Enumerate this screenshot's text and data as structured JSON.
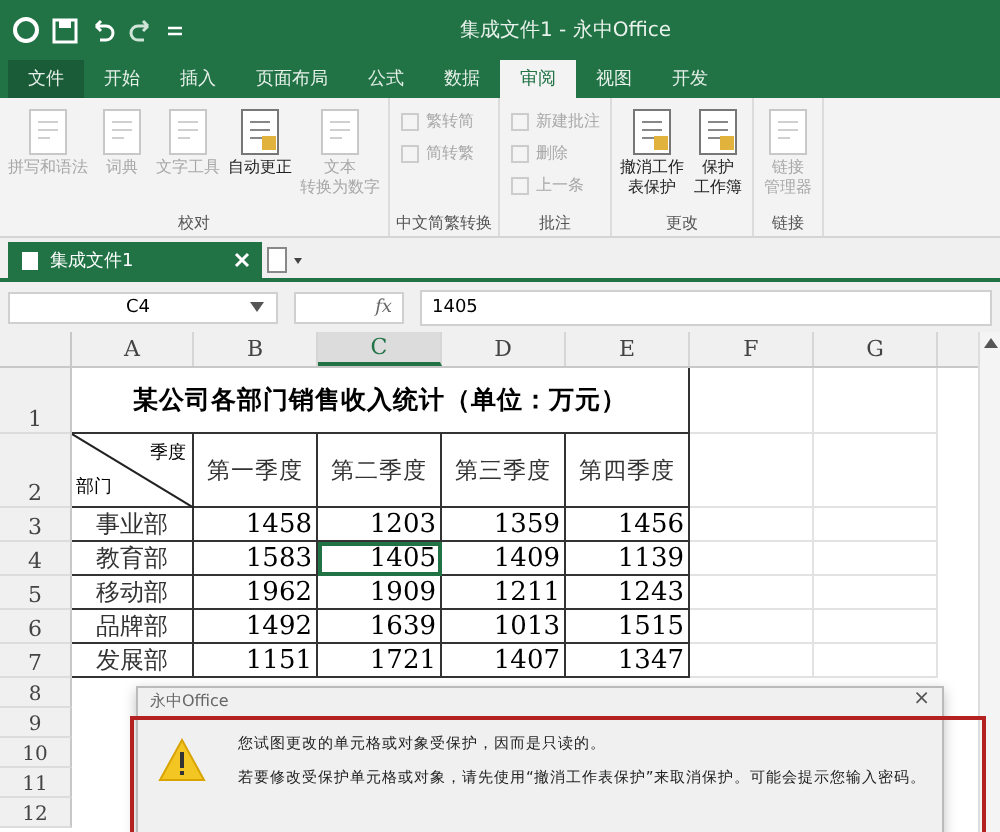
{
  "window": {
    "title": "集成文件1 - 永中Office"
  },
  "menu_tabs": [
    {
      "label": "文件",
      "selected": false,
      "kind": "file"
    },
    {
      "label": "开始",
      "selected": false,
      "kind": "tab"
    },
    {
      "label": "插入",
      "selected": false,
      "kind": "tab"
    },
    {
      "label": "页面布局",
      "selected": false,
      "kind": "tab"
    },
    {
      "label": "公式",
      "selected": false,
      "kind": "tab"
    },
    {
      "label": "数据",
      "selected": false,
      "kind": "tab"
    },
    {
      "label": "审阅",
      "selected": true,
      "kind": "tab"
    },
    {
      "label": "视图",
      "selected": false,
      "kind": "tab"
    },
    {
      "label": "开发",
      "selected": false,
      "kind": "tab"
    }
  ],
  "ribbon": {
    "groups": [
      {
        "label": "校对",
        "items": [
          {
            "lines": [
              "拼写和语法"
            ],
            "kind": "large",
            "disabled": true
          },
          {
            "lines": [
              "词典"
            ],
            "kind": "large",
            "disabled": true
          },
          {
            "lines": [
              "文字工具"
            ],
            "kind": "large",
            "disabled": true
          },
          {
            "lines": [
              "自动更正"
            ],
            "kind": "large",
            "disabled": false
          },
          {
            "lines": [
              "文本",
              "转换为数字"
            ],
            "kind": "large",
            "disabled": true
          }
        ]
      },
      {
        "label": "中文简繁转换",
        "items": [
          {
            "label": "繁转简",
            "kind": "small",
            "disabled": true
          },
          {
            "label": "简转繁",
            "kind": "small",
            "disabled": true
          }
        ]
      },
      {
        "label": "批注",
        "items": [
          {
            "label": "新建批注",
            "kind": "small",
            "disabled": true
          },
          {
            "label": "删除",
            "kind": "small",
            "disabled": true
          },
          {
            "label": "上一条",
            "kind": "small",
            "disabled": true
          }
        ]
      },
      {
        "label": "更改",
        "items": [
          {
            "lines": [
              "撤消工作",
              "表保护"
            ],
            "kind": "large",
            "disabled": false
          },
          {
            "lines": [
              "保护",
              "工作簿"
            ],
            "kind": "large",
            "disabled": false
          }
        ]
      },
      {
        "label": "链接",
        "items": [
          {
            "lines": [
              "链接",
              "管理器"
            ],
            "kind": "large",
            "disabled": true
          }
        ]
      }
    ]
  },
  "doc_tabs": [
    {
      "label": "集成文件1",
      "selected": true
    }
  ],
  "formula_bar": {
    "cell": "C4",
    "fx": "fx",
    "value": "1405"
  },
  "sheet": {
    "columns": [
      {
        "label": "A",
        "selected": false
      },
      {
        "label": "B",
        "selected": false
      },
      {
        "label": "C",
        "selected": true
      },
      {
        "label": "D",
        "selected": false
      },
      {
        "label": "E",
        "selected": false
      },
      {
        "label": "F",
        "selected": false
      },
      {
        "label": "G",
        "selected": false
      }
    ],
    "title_row": {
      "number": "1",
      "text": "某公司各部门销售收入统计（单位：万元）"
    },
    "header_row": {
      "number": "2",
      "corner_top": "季度",
      "corner_bottom": "部门",
      "quarters": [
        "第一季度",
        "第二季度",
        "第三季度",
        "第四季度"
      ]
    },
    "rows": [
      {
        "number": "3",
        "dept": "事业部",
        "values": [
          {
            "text": "1458",
            "selected": false
          },
          {
            "text": "1203",
            "selected": false
          },
          {
            "text": "1359",
            "selected": false
          },
          {
            "text": "1456",
            "selected": false
          }
        ]
      },
      {
        "number": "4",
        "dept": "教育部",
        "values": [
          {
            "text": "1583",
            "selected": false
          },
          {
            "text": "1405",
            "selected": true
          },
          {
            "text": "1409",
            "selected": false
          },
          {
            "text": "1139",
            "selected": false
          }
        ]
      },
      {
        "number": "5",
        "dept": "移动部",
        "values": [
          {
            "text": "1962",
            "selected": false
          },
          {
            "text": "1909",
            "selected": false
          },
          {
            "text": "1211",
            "selected": false
          },
          {
            "text": "1243",
            "selected": false
          }
        ]
      },
      {
        "number": "6",
        "dept": "品牌部",
        "values": [
          {
            "text": "1492",
            "selected": false
          },
          {
            "text": "1639",
            "selected": false
          },
          {
            "text": "1013",
            "selected": false
          },
          {
            "text": "1515",
            "selected": false
          }
        ]
      },
      {
        "number": "7",
        "dept": "发展部",
        "values": [
          {
            "text": "1151",
            "selected": false
          },
          {
            "text": "1721",
            "selected": false
          },
          {
            "text": "1407",
            "selected": false
          },
          {
            "text": "1347",
            "selected": false
          }
        ]
      }
    ],
    "empty_rows": [
      "8",
      "9",
      "10",
      "11",
      "12"
    ]
  },
  "dialog": {
    "title": "永中Office",
    "close": "×",
    "messages": [
      "您试图更改的单元格或对象受保护，因而是只读的。",
      "若要修改受保护单元格或对象，请先使用“撤消工作表保护”来取消保护。可能会提示您输入密码。"
    ]
  }
}
